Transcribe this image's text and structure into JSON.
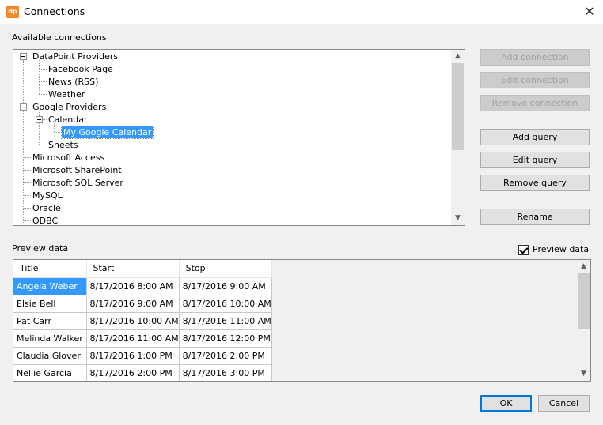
{
  "window": {
    "icon_text": "dp",
    "title": "Connections",
    "close_symbol": "✕"
  },
  "available_label": "Available connections",
  "tree": {
    "nodes": [
      "DataPoint Providers",
      "Facebook Page",
      "News (RSS)",
      "Weather",
      "Google Providers",
      "Calendar",
      "My Google Calendar",
      "Sheets",
      "Microsoft Access",
      "Microsoft SharePoint",
      "Microsoft SQL Server",
      "MySQL",
      "Oracle",
      "ODBC"
    ],
    "selected": "My Google Calendar"
  },
  "buttons": {
    "add_connection": "Add connection",
    "edit_connection": "Edit connection",
    "remove_connection": "Remove connection",
    "add_query": "Add query",
    "edit_query": "Edit query",
    "remove_query": "Remove query",
    "rename": "Rename",
    "ok": "OK",
    "cancel": "Cancel"
  },
  "preview_label": "Preview data",
  "preview_checkbox": {
    "label": "Preview data",
    "checked": true
  },
  "grid": {
    "headers": [
      "Title",
      "Start",
      "Stop"
    ],
    "rows": [
      [
        "Angela Weber",
        "8/17/2016 8:00 AM",
        "8/17/2016 9:00 AM"
      ],
      [
        "Elsie Bell",
        "8/17/2016 9:00 AM",
        "8/17/2016 10:00 AM"
      ],
      [
        "Pat Carr",
        "8/17/2016 10:00 AM",
        "8/17/2016 11:00 AM"
      ],
      [
        "Melinda Walker",
        "8/17/2016 11:00 AM",
        "8/17/2016 12:00 PM"
      ],
      [
        "Claudia Glover",
        "8/17/2016 1:00 PM",
        "8/17/2016 2:00 PM"
      ],
      [
        "Nellie Garcia",
        "8/17/2016 2:00 PM",
        "8/17/2016 3:00 PM"
      ]
    ]
  },
  "colors": {
    "selection": "#3399ff",
    "default_button_border": "#0078d7",
    "icon": "#f28c22"
  },
  "icons": {
    "scroll_up": "▲",
    "scroll_down": "▼"
  }
}
